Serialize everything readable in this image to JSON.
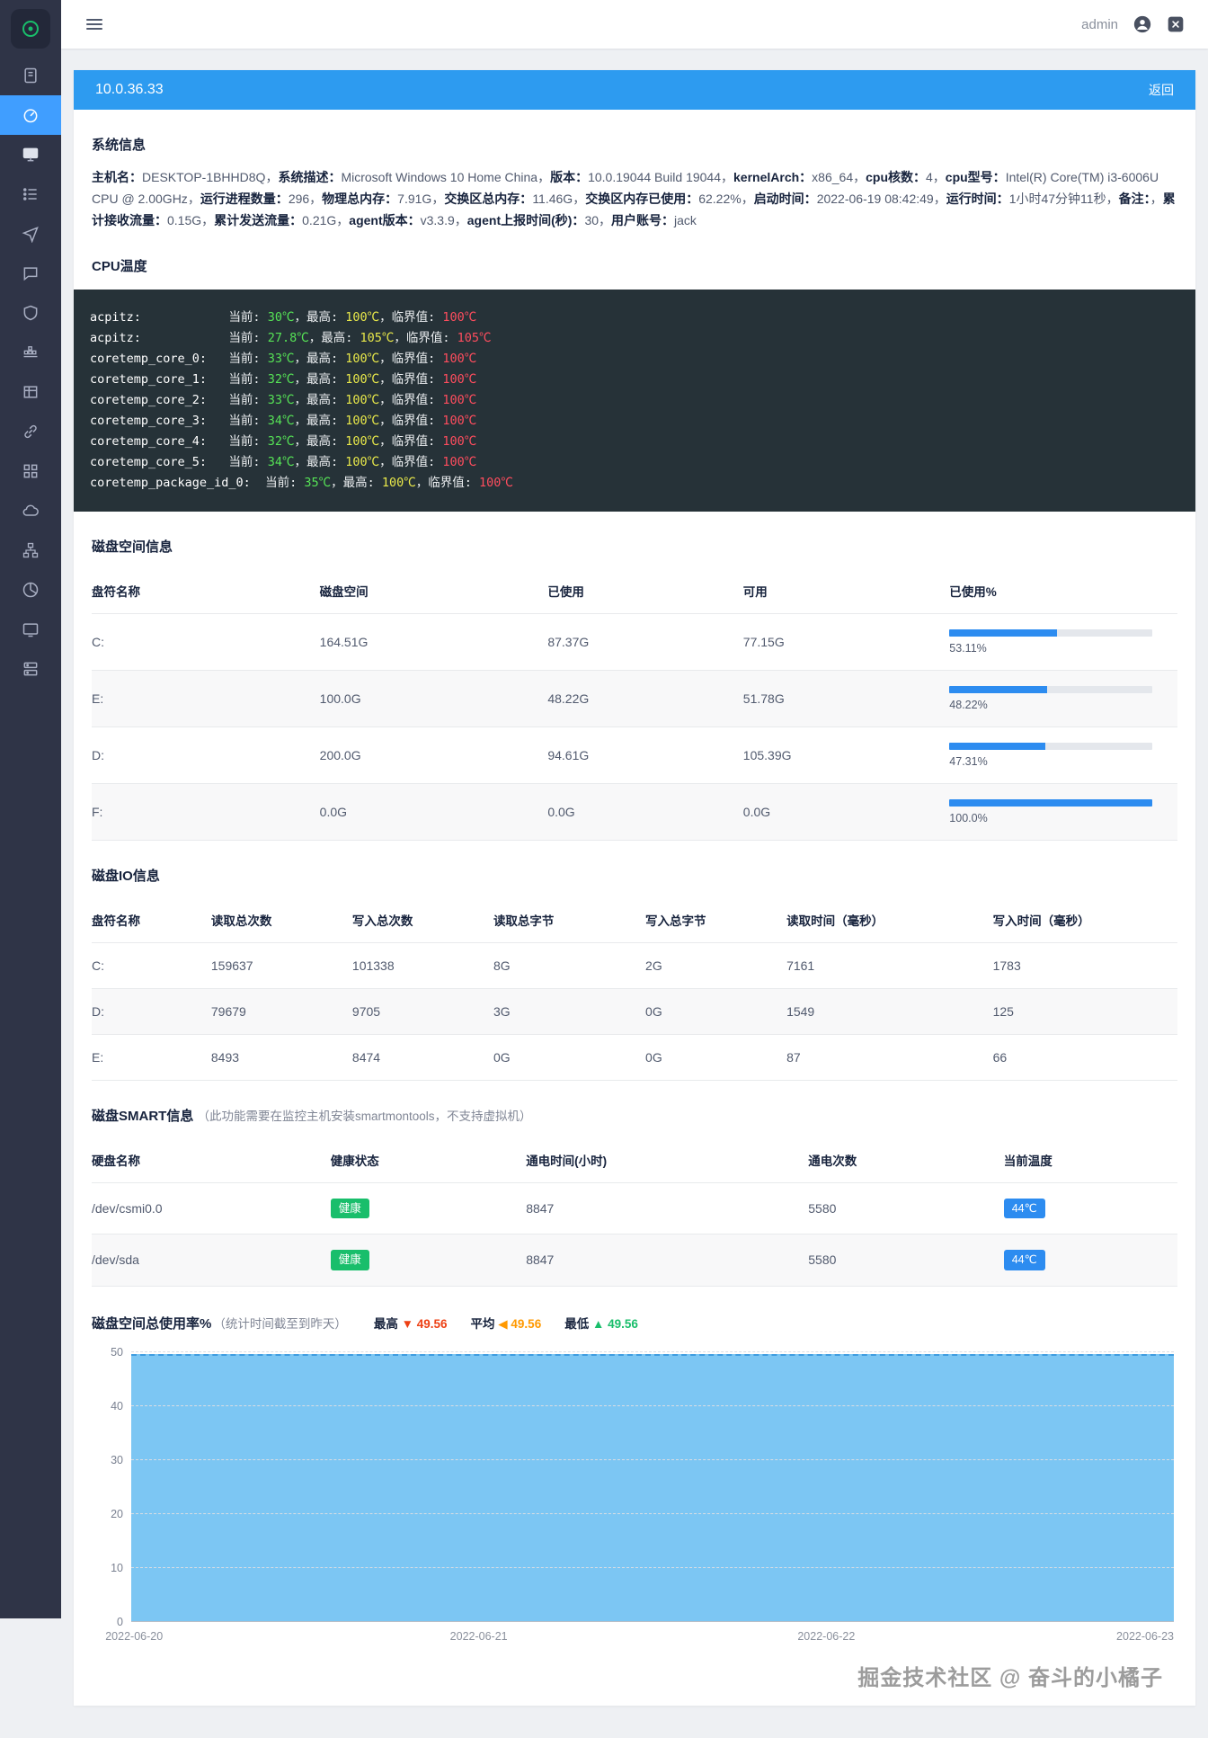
{
  "colors": {
    "accent_blue": "#2d8cf0",
    "sidebar_bg": "#2f3447",
    "sidebar_active": "#409eff",
    "health_green": "#19be6b",
    "temp_badge_blue": "#2d8cf0",
    "console_current_green": "#56e356",
    "console_max_yellow": "#e8e84a",
    "console_critical_red": "#ff4d5e",
    "stat_high_red": "#ed4014",
    "stat_avg_orange": "#ff9900",
    "stat_low_green": "#19be6b",
    "chart_fill": "#7cc6f3"
  },
  "sidebar": {
    "logo_icon": "wgcloud-logo",
    "icons": [
      "book-icon",
      "gauge-icon",
      "monitor-icon",
      "task-list-icon",
      "send-icon",
      "chat-icon",
      "shield-icon",
      "docker-icon",
      "table-icon",
      "link-icon",
      "apps-grid-icon",
      "cloud-icon",
      "topology-icon",
      "pie-chart-icon",
      "display-icon",
      "server-stack-icon"
    ]
  },
  "topbar": {
    "username": "admin"
  },
  "host_header": {
    "ip": "10.0.36.33",
    "back_label": "返回"
  },
  "system_info": {
    "title": "系统信息",
    "pairs": [
      {
        "label": "主机名：",
        "value": "DESKTOP-1BHHD8Q"
      },
      {
        "label": "系统描述：",
        "value": "Microsoft Windows 10 Home China"
      },
      {
        "label": "版本：",
        "value": "10.0.19044 Build 19044"
      },
      {
        "label": "kernelArch：",
        "value": "x86_64"
      },
      {
        "label": "cpu核数：",
        "value": "4"
      },
      {
        "label": "cpu型号：",
        "value": "Intel(R) Core(TM) i3-6006U CPU @ 2.00GHz"
      },
      {
        "label": "运行进程数量：",
        "value": "296"
      },
      {
        "label": "物理总内存：",
        "value": "7.91G"
      },
      {
        "label": "交换区总内存：",
        "value": "11.46G"
      },
      {
        "label": "交换区内存已使用：",
        "value": "62.22%"
      },
      {
        "label": "启动时间：",
        "value": "2022-06-19 08:42:49"
      },
      {
        "label": "运行时间：",
        "value": "1小时47分钟11秒"
      },
      {
        "label": "备注：",
        "value": ""
      },
      {
        "label": "累计接收流量：",
        "value": "0.15G"
      },
      {
        "label": "累计发送流量：",
        "value": "0.21G"
      },
      {
        "label": "agent版本：",
        "value": "v3.3.9"
      },
      {
        "label": "agent上报时间(秒)：",
        "value": "30"
      },
      {
        "label": "用户账号：",
        "value": "jack"
      }
    ]
  },
  "cpu_temp": {
    "title": "CPU温度",
    "label_current": "当前: ",
    "label_max": "，最高: ",
    "label_critical": "，临界值: ",
    "sensors": [
      {
        "name": "acpitz:",
        "current": "30℃",
        "max": "100℃",
        "critical": "100℃"
      },
      {
        "name": "acpitz:",
        "current": "27.8℃",
        "max": "105℃",
        "critical": "105℃"
      },
      {
        "name": "coretemp_core_0:",
        "current": "33℃",
        "max": "100℃",
        "critical": "100℃"
      },
      {
        "name": "coretemp_core_1:",
        "current": "32℃",
        "max": "100℃",
        "critical": "100℃"
      },
      {
        "name": "coretemp_core_2:",
        "current": "33℃",
        "max": "100℃",
        "critical": "100℃"
      },
      {
        "name": "coretemp_core_3:",
        "current": "34℃",
        "max": "100℃",
        "critical": "100℃"
      },
      {
        "name": "coretemp_core_4:",
        "current": "32℃",
        "max": "100℃",
        "critical": "100℃"
      },
      {
        "name": "coretemp_core_5:",
        "current": "34℃",
        "max": "100℃",
        "critical": "100℃"
      },
      {
        "name": "coretemp_package_id_0:",
        "current": "35℃",
        "max": "100℃",
        "critical": "100℃"
      }
    ]
  },
  "disk_space": {
    "title": "磁盘空间信息",
    "headers": [
      "盘符名称",
      "磁盘空间",
      "已使用",
      "可用",
      "已使用%"
    ],
    "rows": [
      {
        "name": "C:",
        "total": "164.51G",
        "used": "87.37G",
        "free": "77.15G",
        "percent": 53.11,
        "percent_label": "53.11%"
      },
      {
        "name": "E:",
        "total": "100.0G",
        "used": "48.22G",
        "free": "51.78G",
        "percent": 48.22,
        "percent_label": "48.22%"
      },
      {
        "name": "D:",
        "total": "200.0G",
        "used": "94.61G",
        "free": "105.39G",
        "percent": 47.31,
        "percent_label": "47.31%"
      },
      {
        "name": "F:",
        "total": "0.0G",
        "used": "0.0G",
        "free": "0.0G",
        "percent": 100,
        "percent_label": "100.0%"
      }
    ]
  },
  "disk_io": {
    "title": "磁盘IO信息",
    "headers": [
      "盘符名称",
      "读取总次数",
      "写入总次数",
      "读取总字节",
      "写入总字节",
      "读取时间（毫秒）",
      "写入时间（毫秒）"
    ],
    "rows": [
      [
        "C:",
        "159637",
        "101338",
        "8G",
        "2G",
        "7161",
        "1783"
      ],
      [
        "D:",
        "79679",
        "9705",
        "3G",
        "0G",
        "1549",
        "125"
      ],
      [
        "E:",
        "8493",
        "8474",
        "0G",
        "0G",
        "87",
        "66"
      ]
    ]
  },
  "smart": {
    "title": "磁盘SMART信息",
    "subtitle": "（此功能需要在监控主机安装smartmontools，不支持虚拟机）",
    "headers": [
      "硬盘名称",
      "健康状态",
      "通电时间(小时)",
      "通电次数",
      "当前温度"
    ],
    "rows": [
      {
        "name": "/dev/csmi0.0",
        "health": "健康",
        "hours": "8847",
        "count": "5580",
        "temp": "44℃"
      },
      {
        "name": "/dev/sda",
        "health": "健康",
        "hours": "8847",
        "count": "5580",
        "temp": "44℃"
      }
    ]
  },
  "usage_chart": {
    "title": "磁盘空间总使用率%",
    "subtitle": "（统计时间截至到昨天）",
    "stats": [
      {
        "label": "最高",
        "arrow": "▼",
        "value": "49.56",
        "color": "#ed4014"
      },
      {
        "label": "平均",
        "arrow": "◀",
        "value": "49.56",
        "color": "#ff9900"
      },
      {
        "label": "最低",
        "arrow": "▲",
        "value": "49.56",
        "color": "#19be6b"
      }
    ]
  },
  "chart_data": {
    "type": "area",
    "title": "磁盘空间总使用率%",
    "x": [
      "2022-06-20",
      "2022-06-21",
      "2022-06-22",
      "2022-06-23"
    ],
    "values": [
      49.56,
      49.56,
      49.56,
      49.56
    ],
    "ylim": [
      0,
      50
    ],
    "yticks": [
      0,
      10,
      20,
      30,
      40,
      50
    ],
    "xlabel": "",
    "ylabel": "",
    "grid": "dashed-horizontal",
    "legend": "none",
    "fill_color": "#7cc6f3"
  },
  "watermark": "掘金技术社区 @ 奋斗的小橘子"
}
